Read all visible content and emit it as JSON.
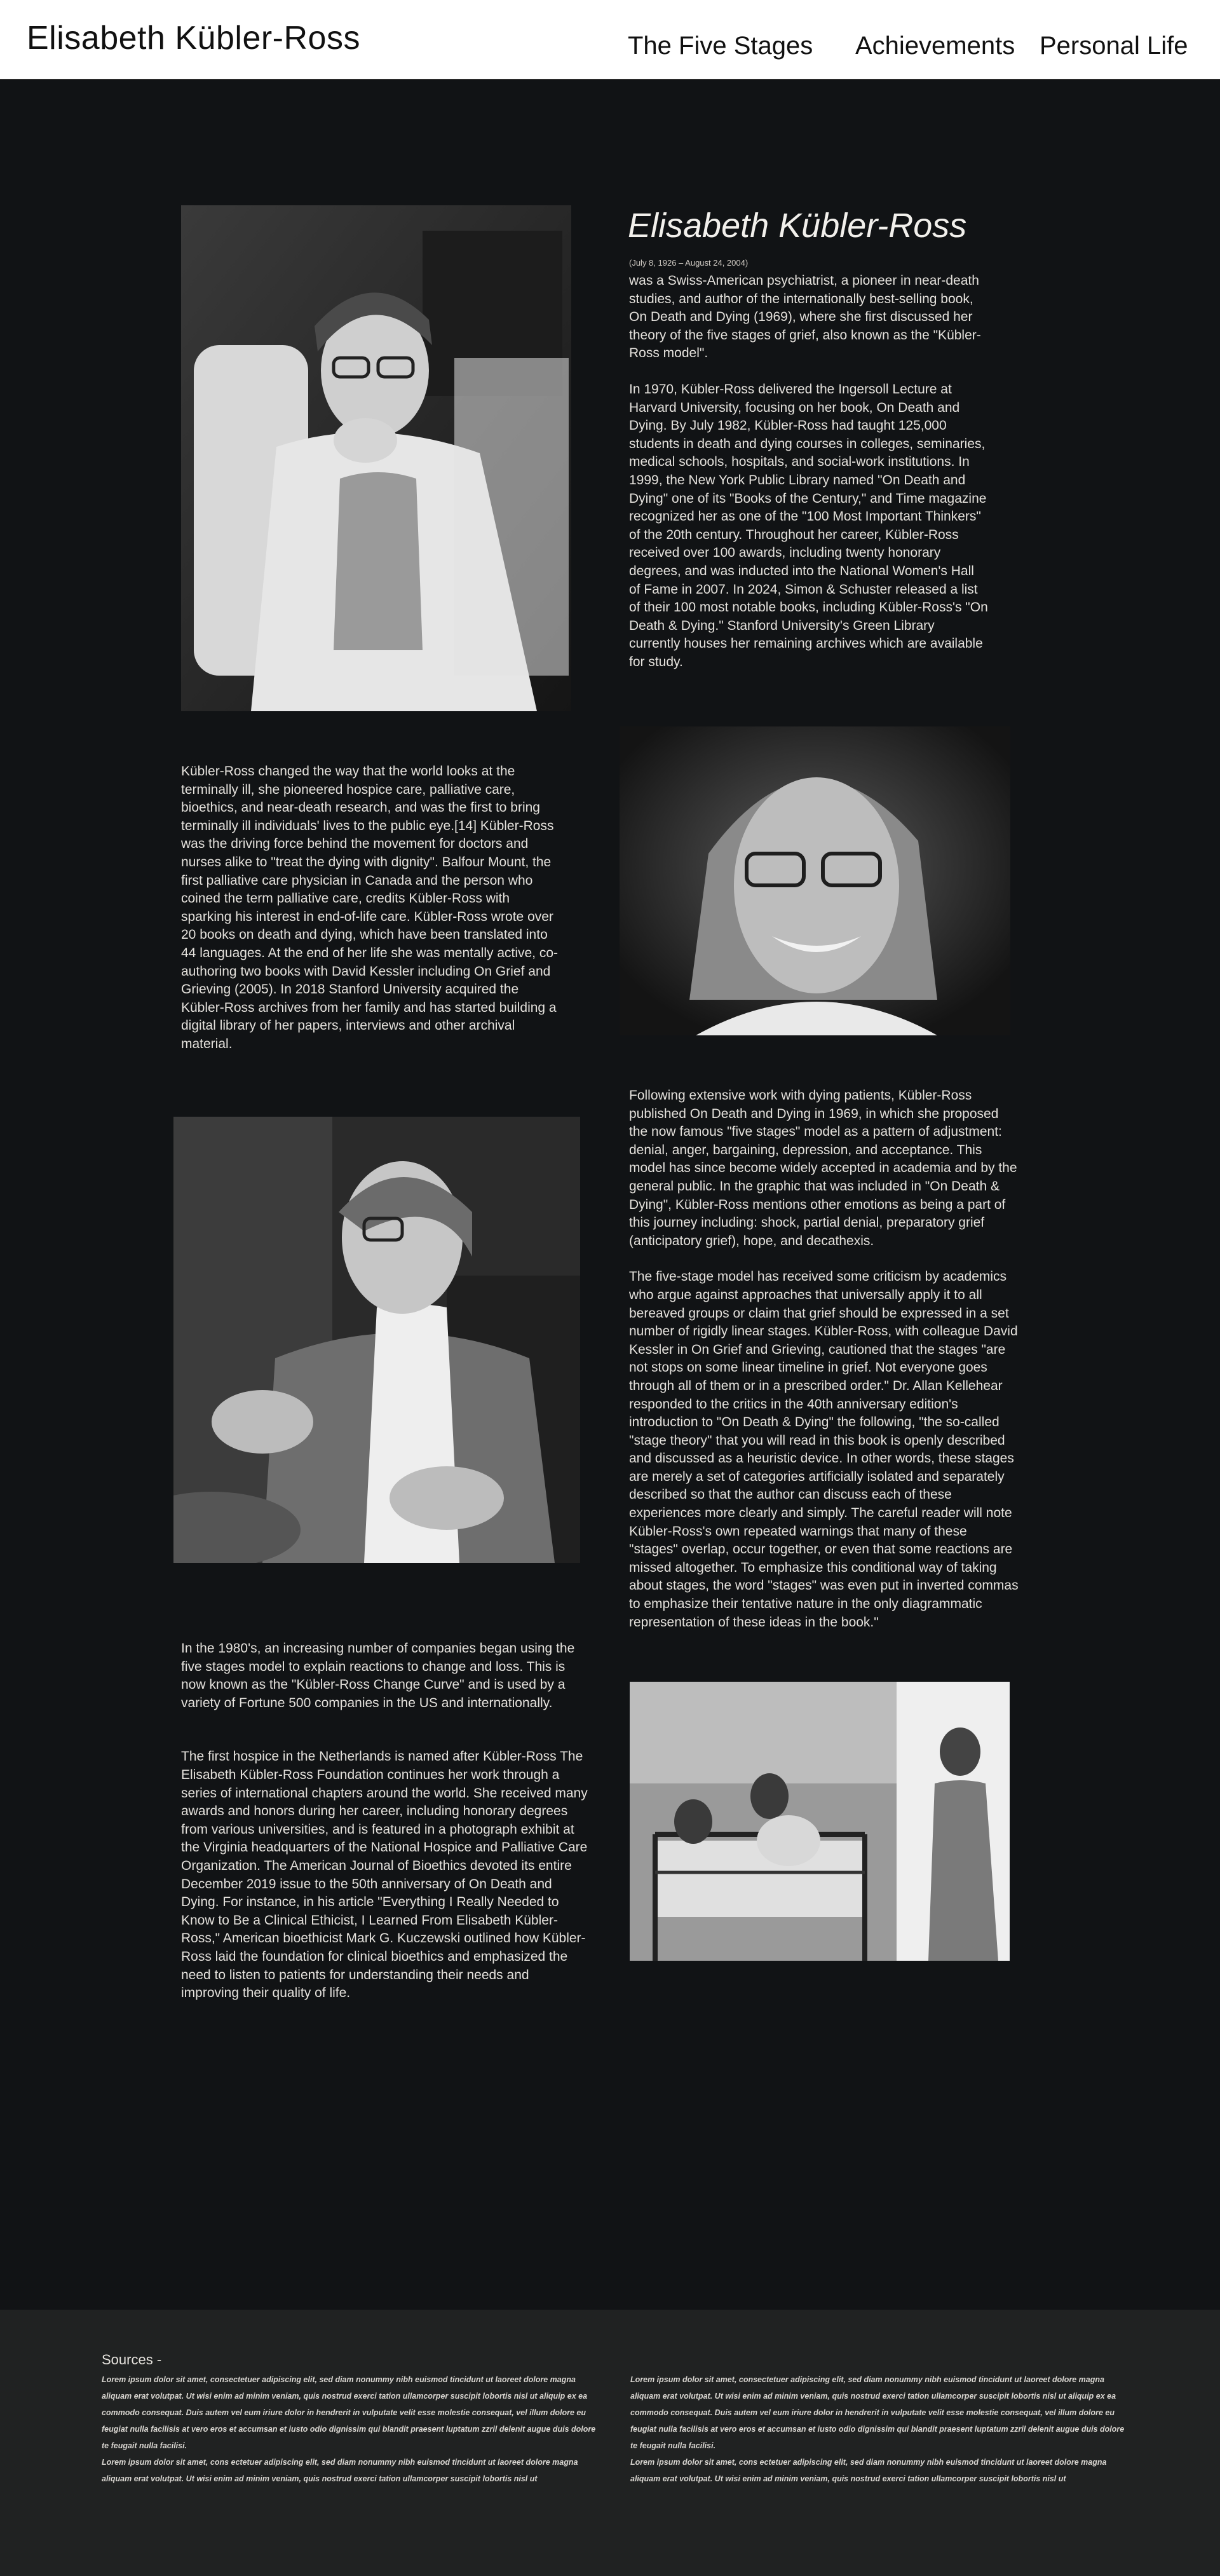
{
  "header": {
    "title": "Elisabeth Kübler-Ross",
    "nav": [
      "The Five Stages",
      "Achievements",
      "Personal Life"
    ]
  },
  "intro": {
    "name": "Elisabeth Kübler-Ross",
    "dates": "(July 8, 1926 – August 24, 2004)",
    "para1": "was a Swiss-American psychiatrist, a pioneer in near-death studies, and author of the internationally best-selling book, On Death and Dying (1969), where she first discussed her theory of the five stages of grief, also known as the \"Kübler-Ross model\".",
    "para2": "In 1970, Kübler-Ross delivered the Ingersoll Lecture at Harvard University, focusing on her book, On Death and Dying. By July 1982, Kübler-Ross had taught 125,000 students in death and dying courses in colleges, seminaries, medical schools, hospitals, and social-work institutions. In 1999, the New York Public Library named \"On Death and Dying\" one of its \"Books of the Century,\" and Time magazine recognized her as one of the \"100 Most Important Thinkers\" of the 20th century. Throughout her career, Kübler-Ross received over 100 awards, including twenty honorary degrees, and was inducted into the National Women's Hall of Fame in 2007. In 2024, Simon & Schuster released a list of their 100 most notable books, including Kübler-Ross's \"On Death & Dying.\" Stanford University's Green Library currently houses her remaining archives which are available for study."
  },
  "section2": {
    "para": "Kübler-Ross changed the way that the world looks at the terminally ill, she pioneered hospice care, palliative care, bioethics, and near-death research, and was the first to bring terminally ill individuals' lives to the public eye.[14] Kübler-Ross was the driving force behind the movement for doctors and nurses alike to \"treat the dying with dignity\". Balfour Mount, the first palliative care physician in Canada and the person who coined the term palliative care, credits Kübler-Ross with sparking his interest in end-of-life care. Kübler-Ross wrote over 20 books on death and dying, which have been translated into 44 languages. At the end of her life she was mentally active, co-authoring two books with David Kessler including On Grief and Grieving (2005). In 2018 Stanford University acquired the Kübler-Ross archives from her family and has started building a digital library of her papers, interviews and other archival material."
  },
  "section3": {
    "para1": "Following extensive work with dying patients, Kübler-Ross published On Death and Dying in 1969, in which she proposed the now famous \"five stages\" model as a pattern of adjustment: denial, anger, bargaining, depression, and acceptance. This model has since become widely accepted in academia and by the general public. In the graphic that was included in \"On Death & Dying\", Kübler-Ross mentions other emotions as being a part of this journey including: shock, partial denial, preparatory grief (anticipatory grief), hope, and decathexis.",
    "para2": "The five-stage model has received some criticism by academics who argue against approaches that universally apply it to all bereaved groups or claim that grief should be expressed in a set number of rigidly linear stages. Kübler-Ross, with colleague David Kessler in On Grief and Grieving, cautioned that the stages \"are not stops on some linear timeline in grief. Not everyone goes through all of them or in a prescribed order.\" Dr. Allan Kellehear responded to the critics in the 40th anniversary edition's introduction to \"On Death & Dying\" the following, \"the so-called \"stage theory\" that you will read in this book is openly described and discussed as a heuristic device. In other words, these stages are merely a set of categories artificially isolated and separately described so that the author can discuss each of these experiences more clearly and simply. The careful reader will note Kübler-Ross's own repeated warnings that many of these \"stages\" overlap, occur together, or even that some reactions are missed altogether. To emphasize this conditional way of taking about stages, the word \"stages\" was even put in inverted commas to emphasize their tentative nature in the only diagrammatic representation of these ideas in the book.\""
  },
  "section4": {
    "para1": "In the 1980's, an increasing number of companies began using the five stages model to explain reactions to change and loss. This is now known as the \"Kübler-Ross Change Curve\" and is used by a variety of Fortune 500 companies in the US and internationally.",
    "para2": "The first hospice in the Netherlands is named after Kübler-Ross The Elisabeth Kübler-Ross Foundation continues her work through a series of international chapters around the world. She received many awards and honors during her career, including honorary degrees from various universities, and is featured in a photograph exhibit at the Virginia headquarters of the National Hospice and Palliative Care Organization. The American Journal of Bioethics devoted its entire December 2019 issue to the 50th anniversary of On Death and Dying. For instance, in his article \"Everything I Really Needed to Know to Be a Clinical Ethicist, I Learned From Elisabeth Kübler-Ross,\" American bioethicist Mark G. Kuczewski outlined how Kübler-Ross laid the foundation for clinical bioethics and emphasized the need to listen to patients for understanding their needs and improving their quality of life."
  },
  "footer": {
    "sources_label": "Sources -",
    "left": [
      "Lorem ipsum dolor sit amet, consectetuer adipiscing elit, sed diam nonummy nibh euismod tincidunt ut laoreet dolore magna aliquam erat volutpat. Ut wisi enim ad minim veniam, quis nostrud exerci tation ullamcorper suscipit lobortis nisl ut aliquip ex ea commodo consequat. Duis autem vel eum iriure dolor in hendrerit in vulputate velit esse molestie consequat, vel illum dolore eu feugiat nulla facilisis at vero eros et accumsan et iusto odio dignissim qui blandit praesent luptatum zzril delenit augue duis dolore te feugait nulla facilisi.",
      "Lorem ipsum dolor sit amet, cons ectetuer adipiscing elit, sed diam nonummy nibh euismod tincidunt ut laoreet dolore magna aliquam erat volutpat. Ut wisi enim ad minim veniam, quis nostrud exerci tation ullamcorper suscipit lobortis nisl ut"
    ],
    "right": [
      "Lorem ipsum dolor sit amet, consectetuer adipiscing elit, sed diam nonummy nibh euismod tincidunt ut laoreet dolore magna aliquam erat volutpat. Ut wisi enim ad minim veniam, quis nostrud exerci tation ullamcorper suscipit lobortis nisl ut aliquip ex ea commodo consequat. Duis autem vel eum iriure dolor in hendrerit in vulputate velit esse molestie consequat, vel illum dolore eu feugiat nulla facilisis at vero eros et accumsan et iusto odio dignissim qui blandit praesent luptatum zzril delenit augue duis dolore te feugait nulla facilisi.",
      "Lorem ipsum dolor sit amet, cons ectetuer adipiscing elit, sed diam nonummy nibh euismod tincidunt ut laoreet dolore magna aliquam erat volutpat. Ut wisi enim ad minim veniam, quis nostrud exerci tation ullamcorper suscipit lobortis nisl ut"
    ]
  },
  "colors": {
    "background": "#111315",
    "header": "#ffffff",
    "footer": "#202222",
    "text": "#e4e1dc"
  }
}
